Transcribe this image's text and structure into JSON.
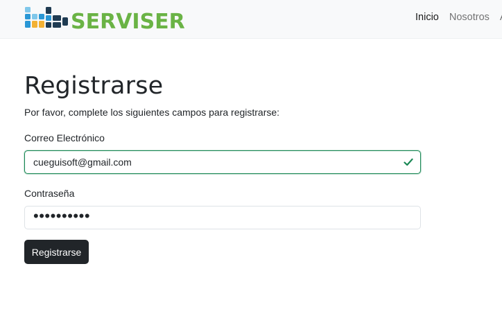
{
  "brand": {
    "name": "SERVISER",
    "logo_icon": "block-letters-logo-icon",
    "colors": {
      "green": "#6ab345",
      "dark": "#1f3b52",
      "blue": "#2a97d5",
      "light_blue": "#7fc7ea",
      "yellow": "#f2b134"
    }
  },
  "nav": {
    "links": [
      {
        "label": "Inicio",
        "active": true
      },
      {
        "label": "Nosotros",
        "active": false
      },
      {
        "label": "A",
        "active": false
      }
    ]
  },
  "form": {
    "title": "Registrarse",
    "intro": "Por favor, complete los siguientes campos para registrarse:",
    "email": {
      "label": "Correo Electrónico",
      "value": "cueguisoft@gmail.com",
      "state": "valid",
      "icon": "checkmark-icon"
    },
    "password": {
      "label": "Contraseña",
      "value": "••••••••••"
    },
    "submit_label": "Registrarse"
  },
  "colors": {
    "valid": "#198754",
    "button": "#212529",
    "navbar_bg": "#f8f9fa"
  }
}
